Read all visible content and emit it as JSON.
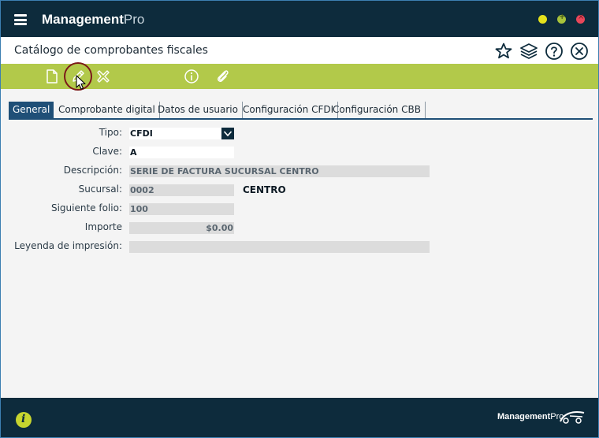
{
  "app": {
    "brand_bold": "Management",
    "brand_light": "Pro"
  },
  "header": {
    "title": "Catálogo de comprobantes fiscales",
    "icons": [
      "star-icon",
      "layers-icon",
      "help-icon",
      "close-icon"
    ]
  },
  "toolbar": {
    "icons": [
      "new-document-icon",
      "edit-pencil-icon",
      "delete-x-icon",
      "info-icon",
      "attachment-icon"
    ]
  },
  "tabs": [
    {
      "label": "General",
      "active": true
    },
    {
      "label": "Comprobante digital",
      "active": false
    },
    {
      "label": "Datos de usuario",
      "active": false
    },
    {
      "label": "Configuración CFDI",
      "active": false
    },
    {
      "label": "Configuración CBB",
      "active": false
    }
  ],
  "form": {
    "tipo": {
      "label": "Tipo:",
      "value": "CFDI"
    },
    "clave": {
      "label": "Clave:",
      "value": "A"
    },
    "descripcion": {
      "label": "Descripción:",
      "value": "SERIE DE FACTURA SUCURSAL CENTRO"
    },
    "sucursal": {
      "label": "Sucursal:",
      "value": "0002",
      "name": "CENTRO"
    },
    "siguiente_folio": {
      "label": "Siguiente folio:",
      "value": "100"
    },
    "importe": {
      "label": "Importe",
      "value": "$0.00"
    },
    "leyenda": {
      "label": "Leyenda de impresión:",
      "value": ""
    }
  },
  "footer": {
    "brand_bold": "Management",
    "brand_light": "Pro"
  },
  "colors": {
    "titlebar": "#0d2b3c",
    "toolbar": "#b2c94a",
    "tab_active": "#1f4f77"
  }
}
